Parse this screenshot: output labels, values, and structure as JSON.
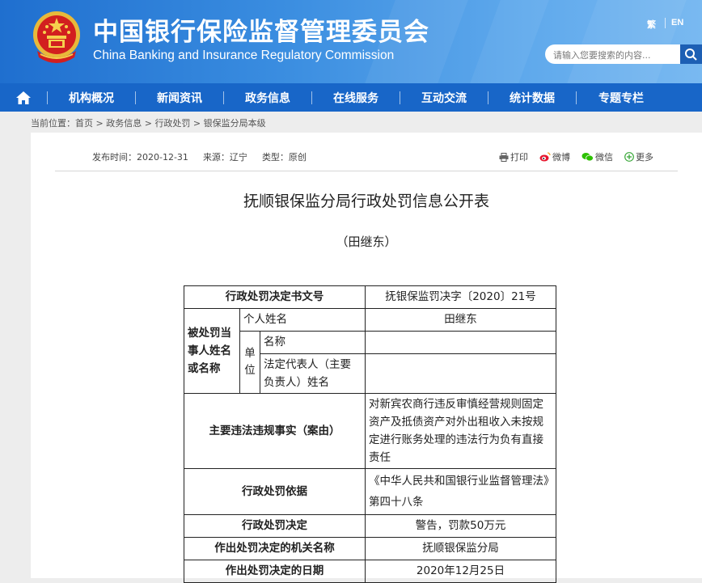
{
  "header": {
    "title_cn": "中国银行保险监督管理委员会",
    "title_en": "China Banking and Insurance Regulatory Commission",
    "lang_trad": "繁",
    "lang_en": "EN",
    "search_placeholder": "请输入您要搜索的内容..."
  },
  "nav": {
    "items": [
      "机构概况",
      "新闻资讯",
      "政务信息",
      "在线服务",
      "互动交流",
      "统计数据",
      "专题专栏"
    ]
  },
  "breadcrumb": {
    "prefix": "当前位置：",
    "items": [
      "首页",
      "政务信息",
      "行政处罚",
      "银保监分局本级"
    ],
    "separator": " > "
  },
  "article": {
    "publish_time": "发布时间：2020-12-31",
    "source": "来源：辽宁",
    "type": "类型：原创",
    "share": {
      "print": "打印",
      "weibo": "微博",
      "wechat": "微信",
      "more": "更多"
    },
    "title": "抚顺银保监分局行政处罚信息公开表",
    "subtitle": "（田继东）"
  },
  "penalty_table": {
    "doc_no_label": "行政处罚决定书文号",
    "doc_no_value": "抚银保监罚决字〔2020〕21号",
    "party_label": "被处罚当事人姓名或名称",
    "person_label": "个人姓名",
    "person_value": "田继东",
    "unit_label": "单位",
    "unit_name_label": "名称",
    "unit_name_value": "",
    "legal_rep_label": "法定代表人（主要负责人）姓名",
    "legal_rep_value": "",
    "violation_label": "主要违法违规事实（案由）",
    "violation_value": "对新宾农商行违反审慎经营规则固定资产及抵债资产对外出租收入未按规定进行账务处理的违法行为负有直接责任",
    "basis_label": "行政处罚依据",
    "basis_value": "《中华人民共和国银行业监督管理法》第四十八条",
    "decision_label": "行政处罚决定",
    "decision_value": "警告，罚款50万元",
    "authority_label": "作出处罚决定的机关名称",
    "authority_value": "抚顺银保监分局",
    "date_label": "作出处罚决定的日期",
    "date_value": "2020年12月25日"
  },
  "colors": {
    "banner": "#2f80d8",
    "nav": "#1866c8",
    "search_button": "#1d5fb4"
  }
}
